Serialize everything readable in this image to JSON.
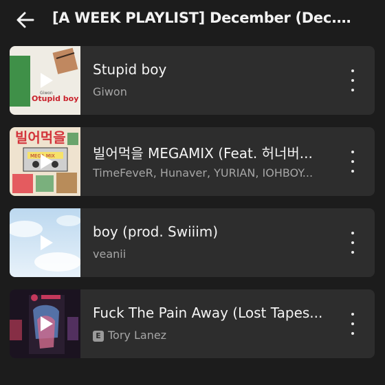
{
  "header": {
    "title": "[A WEEK PLAYLIST] December  (Dec.) 2...",
    "back_icon": "arrow-left-icon"
  },
  "tracks": [
    {
      "title": "Stupid boy",
      "artist": "Giwon",
      "explicit": false,
      "explicit_label": "",
      "thumb_colors": [
        "#f1eee6",
        "#3e8f47",
        "#b5794f"
      ]
    },
    {
      "title": "빌어먹을 MEGAMIX (Feat. 허너버...",
      "artist": "TimeFeveR, Hunaver, YURIAN, IOHBOY...",
      "explicit": false,
      "explicit_label": "",
      "thumb_colors": [
        "#efe2cf",
        "#d3343b",
        "#6aa46c"
      ]
    },
    {
      "title": "boy (prod. Swiiim)",
      "artist": "veanii",
      "explicit": false,
      "explicit_label": "",
      "thumb_colors": [
        "#cfe3f3",
        "#eef6fb",
        "#9fc3e0"
      ]
    },
    {
      "title": "Fuck The Pain Away (Lost Tapes...",
      "artist": "Tory Lanez",
      "explicit": true,
      "explicit_label": "E",
      "thumb_colors": [
        "#1d1320",
        "#c4385c",
        "#5f86c4"
      ]
    }
  ]
}
